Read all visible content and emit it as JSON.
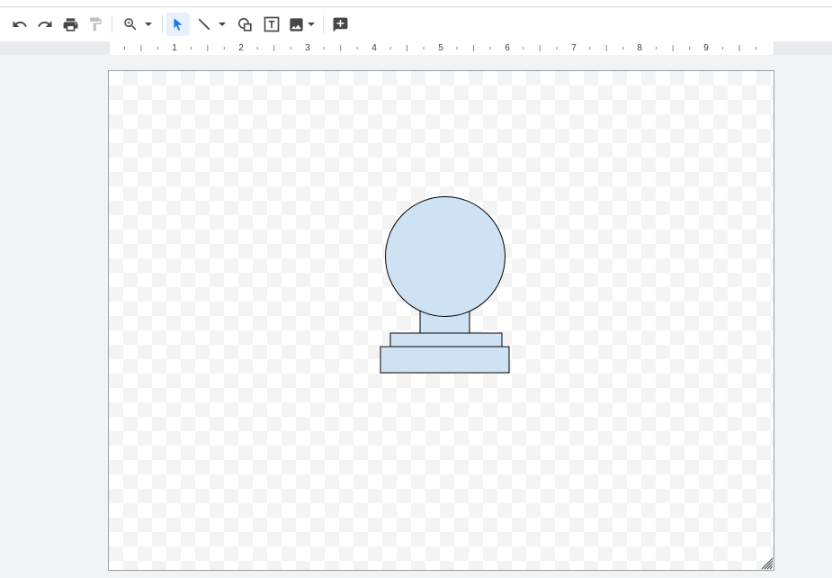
{
  "toolbar": {
    "icons": [
      "undo-icon",
      "redo-icon",
      "print-icon",
      "paint-format-icon",
      "zoom-icon",
      "select-icon",
      "line-icon",
      "shape-icon",
      "text-box-icon",
      "image-icon",
      "add-comment-icon"
    ],
    "active_tool": "select",
    "accent_color": "#1a73e8"
  },
  "ruler": {
    "labels": [
      "1",
      "2",
      "3",
      "4",
      "5",
      "6",
      "7",
      "8",
      "9"
    ]
  },
  "drawing": {
    "shape_fill": "#cfe2f3",
    "shape_stroke": "#000000",
    "shapes": [
      "circle",
      "neck-rectangle",
      "top-base-rectangle",
      "bottom-base-rectangle"
    ]
  }
}
